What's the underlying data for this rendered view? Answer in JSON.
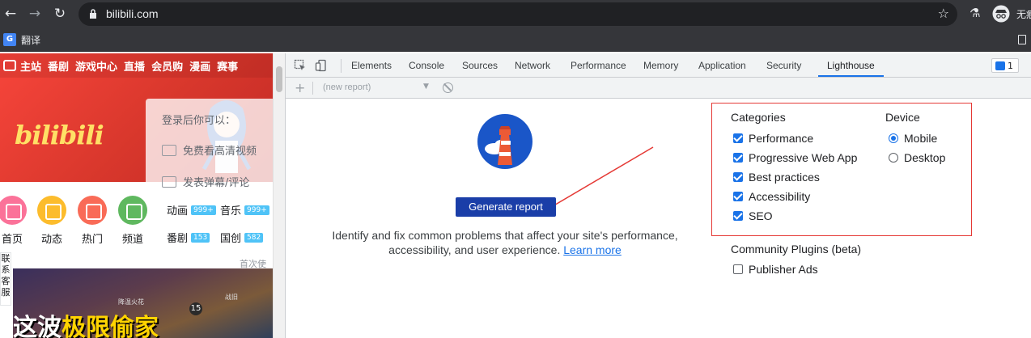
{
  "browser": {
    "url": "bilibili.com",
    "profile_label": "无痕",
    "bookmark_label": "翻译",
    "bookmark_icon_text": "G"
  },
  "page": {
    "topnav": [
      "主站",
      "番剧",
      "游戏中心",
      "直播",
      "会员购",
      "漫画",
      "赛事"
    ],
    "logo_text": "bilibili",
    "login_panel": {
      "title": "登录后你可以：",
      "row1": "免费看高清视频",
      "row2": "发表弹幕/评论",
      "stats": [
        {
          "label": "动画",
          "badge": "999+"
        },
        {
          "label": "音乐",
          "badge": "999+"
        },
        {
          "label": "番剧",
          "badge": "153"
        },
        {
          "label": "国创",
          "badge": "582"
        }
      ],
      "footer": "首次使"
    },
    "channels": [
      {
        "label": "首页",
        "color": "#fb7299"
      },
      {
        "label": "动态",
        "color": "#fcbc2c"
      },
      {
        "label": "热门",
        "color": "#f96b57"
      },
      {
        "label": "频道",
        "color": "#5fb85f"
      }
    ],
    "side_tab": "联系客服",
    "game_title_white": "这波",
    "game_title_yellow": "极限偷家",
    "game_hud": {
      "left": "降温火花",
      "badge": "15",
      "right": "战旧"
    }
  },
  "devtools": {
    "tabs": [
      "Elements",
      "Console",
      "Sources",
      "Network",
      "Performance",
      "Memory",
      "Application",
      "Security",
      "Lighthouse"
    ],
    "active_tab": "Lighthouse",
    "issues_count": "1",
    "report_select": "(new report)",
    "generate_button": "Generate report",
    "description_text": "Identify and fix common problems that affect your site's performance, accessibility, and user experience.",
    "learn_more": "Learn more",
    "categories_title": "Categories",
    "categories": [
      {
        "label": "Performance",
        "checked": true
      },
      {
        "label": "Progressive Web App",
        "checked": true
      },
      {
        "label": "Best practices",
        "checked": true
      },
      {
        "label": "Accessibility",
        "checked": true
      },
      {
        "label": "SEO",
        "checked": true
      }
    ],
    "device_title": "Device",
    "devices": [
      {
        "label": "Mobile",
        "selected": true
      },
      {
        "label": "Desktop",
        "selected": false
      }
    ],
    "plugins_title": "Community Plugins (beta)",
    "plugins": [
      {
        "label": "Publisher Ads",
        "checked": false
      }
    ]
  },
  "colors": {
    "accent": "#1a73e8",
    "button": "#1a3ea8",
    "annotation_red": "#e53935",
    "bilibili_red": "#d8372c"
  }
}
